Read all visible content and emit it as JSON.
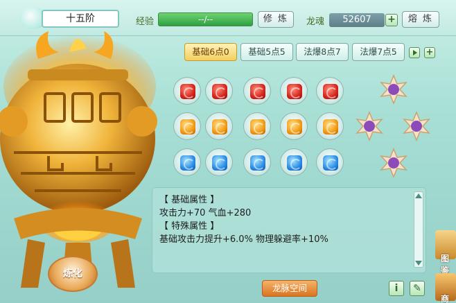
{
  "header": {
    "rank": "十五阶",
    "exp_label": "经验",
    "exp_value": "--/--",
    "cultivate_button": "修 炼",
    "soul_label": "龙魂",
    "soul_value": "52607",
    "smelt_button": "熔 炼"
  },
  "tabs": [
    {
      "label": "基础6点0",
      "active": true
    },
    {
      "label": "基础5点5",
      "active": false
    },
    {
      "label": "法爆8点7",
      "active": false
    },
    {
      "label": "法爆7点5",
      "active": false
    }
  ],
  "gems": {
    "rows": [
      {
        "color": "red",
        "count": 5
      },
      {
        "color": "orange",
        "count": 5
      },
      {
        "color": "blue",
        "count": 5
      }
    ],
    "star_badges": 4
  },
  "attributes": {
    "basic_title": "【 基础属性 】",
    "basic_line": "攻击力+70  气血+280",
    "special_title": "【 特殊属性 】",
    "special_line": "基础攻击力提升+6.0%  物理躲避率+10%"
  },
  "buttons": {
    "refine": "炼化",
    "vein_space": "龙脉空间",
    "info": "i"
  },
  "side": {
    "label_top": "图鉴",
    "label_bottom": "商"
  },
  "colors": {
    "panel_bg": "#a9e0d6",
    "accent_gold": "#f2cf62",
    "exp_green": "#2ea043"
  }
}
